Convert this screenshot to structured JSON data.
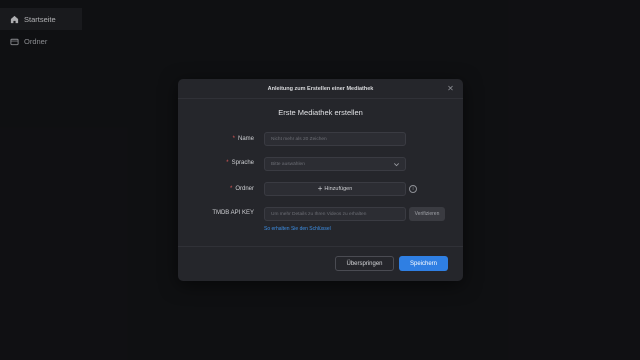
{
  "sidebar": {
    "items": [
      {
        "label": "Startseite",
        "icon": "home-icon",
        "active": true
      },
      {
        "label": "Ordner",
        "icon": "folder-icon",
        "active": false
      }
    ]
  },
  "dialog": {
    "title": "Anleitung zum Erstellen einer Mediathek",
    "subtitle": "Erste Mediathek erstellen",
    "fields": {
      "name": {
        "label": "Name",
        "required": true,
        "placeholder": "Nicht mehr als 20 Zeichen"
      },
      "language": {
        "label": "Sprache",
        "required": true,
        "placeholder": "Bitte auswählen"
      },
      "folder": {
        "label": "Ordner",
        "required": true,
        "button_label": "Hinzufügen"
      },
      "tmdb": {
        "label": "TMDB API KEY",
        "required": false,
        "placeholder": "Um mehr Details zu Ihren Videos zu erhalten",
        "verify_label": "Verifizieren",
        "help_link": "So erhalten Sie den Schlüssel"
      }
    },
    "buttons": {
      "skip": "Überspringen",
      "save": "Speichern"
    }
  },
  "colors": {
    "background": "#151619",
    "dialog": "#25262b",
    "primary": "#2f7fe3",
    "link": "#3d8fe6",
    "required": "#e05a5a"
  }
}
